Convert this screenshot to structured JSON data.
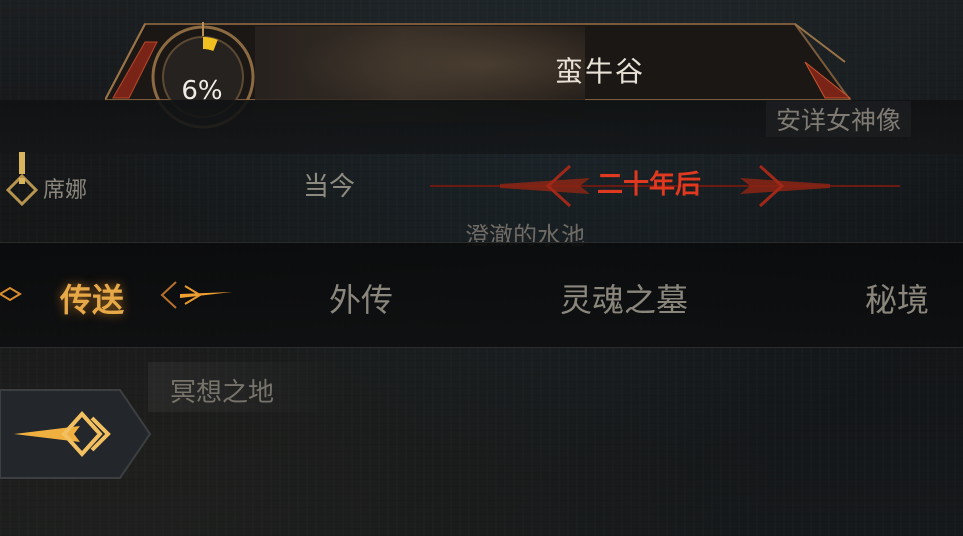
{
  "zone": {
    "title": "蛮牛谷",
    "progress": "6%",
    "progress_value": 0.06
  },
  "waypoints": {
    "top_right": "安详女神像",
    "middle": "澄澈的水池",
    "bottom": "冥想之地"
  },
  "npc": {
    "name": "席娜"
  },
  "era_tabs": {
    "now": "当今",
    "future": "二十年后",
    "selected": "二十年后"
  },
  "category_tabs": [
    {
      "label": "传送",
      "selected": true
    },
    {
      "label": "外传",
      "selected": false
    },
    {
      "label": "灵魂之墓",
      "selected": false
    },
    {
      "label": "秘境",
      "selected": false
    }
  ],
  "colors": {
    "accent_gold": "#e7a948",
    "accent_red": "#e0391f",
    "text_dim": "#8a867c"
  }
}
